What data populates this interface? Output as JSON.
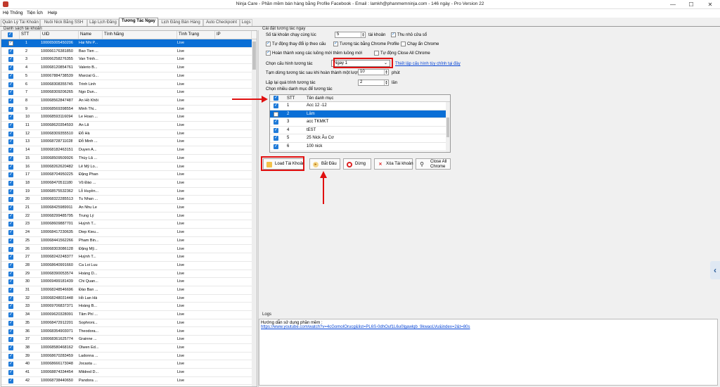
{
  "window": {
    "title": "Ninja Care - Phần mềm bán hàng bằng Profile Facebook - Email : lamkh@phanmemninja.com - 146 ngày - Pro Version 22",
    "minimize": "—",
    "maximize": "☐",
    "close": "✕"
  },
  "menu": [
    "Hệ Thống",
    "Tiện Ích",
    "Help"
  ],
  "tabs": [
    "Quản Lý Tài Khoản",
    "Nuôi Nick Bằng SSH",
    "Lập Lịch Đăng",
    "Tương Tác Ngay",
    "Lịch Đăng Bán Hàng",
    "Auto Checkpoint",
    "Logs"
  ],
  "active_tab": "Tương Tác Ngay",
  "accounts": {
    "group_label": "Danh sách tài khoản",
    "columns": [
      "",
      "STT",
      "UID",
      "Name",
      "Tính Năng",
      "Tình Trạng",
      "IP"
    ],
    "rows": [
      {
        "stt": "1",
        "uid": "100065005450206",
        "name": "Hai Nhi P...",
        "status": "Live"
      },
      {
        "stt": "2",
        "uid": "100066176381850",
        "name": "Bao Tien ...",
        "status": "Live"
      },
      {
        "stt": "3",
        "uid": "100066258276355",
        "name": "Van Trinh...",
        "status": "Live"
      },
      {
        "stt": "4",
        "uid": "100068120854761",
        "name": "Valerio B...",
        "status": "Live"
      },
      {
        "stt": "5",
        "uid": "100067884738539",
        "name": "Marcial G...",
        "status": "Live"
      },
      {
        "stt": "6",
        "uid": "100068308355745",
        "name": "Trinh Linh",
        "status": "Live"
      },
      {
        "stt": "7",
        "uid": "100068309206265",
        "name": "Ngo Dun...",
        "status": "Live"
      },
      {
        "stt": "8",
        "uid": "100068562847487",
        "name": "An Hồ Khôi",
        "status": "Live"
      },
      {
        "stt": "9",
        "uid": "100068569398554",
        "name": "Minh Thi...",
        "status": "Live"
      },
      {
        "stt": "10",
        "uid": "100068593116094",
        "name": "Le Hoan ...",
        "status": "Live"
      },
      {
        "stt": "11",
        "uid": "100068620354593",
        "name": "An Lã",
        "status": "Live"
      },
      {
        "stt": "12",
        "uid": "100068309355510",
        "name": "Đỗ Hà",
        "status": "Live"
      },
      {
        "stt": "13",
        "uid": "100068728711028",
        "name": "Đỗ Minh ...",
        "status": "Live"
      },
      {
        "stt": "14",
        "uid": "100068182463151",
        "name": "Duyen A...",
        "status": "Live"
      },
      {
        "stt": "15",
        "uid": "100068509509926",
        "name": "Thùy Lã ...",
        "status": "Live"
      },
      {
        "stt": "16",
        "uid": "100068262620482",
        "name": "Lê Mỹ Lo...",
        "status": "Live"
      },
      {
        "stt": "17",
        "uid": "100068704950225",
        "name": "Đặng Phan",
        "status": "Live"
      },
      {
        "stt": "18",
        "uid": "100068470511180",
        "name": "Vũ Đào ...",
        "status": "Live"
      },
      {
        "stt": "19",
        "uid": "100068575532362",
        "name": "Lỗ Huyền...",
        "status": "Live"
      },
      {
        "stt": "20",
        "uid": "100068322285513",
        "name": "Tu Nhan ...",
        "status": "Live"
      },
      {
        "stt": "21",
        "uid": "100068425989911",
        "name": "An Nhu Le",
        "status": "Live"
      },
      {
        "stt": "22",
        "uid": "100068299485795",
        "name": "Trung Lý",
        "status": "Live"
      },
      {
        "stt": "23",
        "uid": "100068609887701",
        "name": "Huỳnh T...",
        "status": "Live"
      },
      {
        "stt": "24",
        "uid": "100068417230635",
        "name": "Diep Kieu...",
        "status": "Live"
      },
      {
        "stt": "25",
        "uid": "100068441562266",
        "name": "Pham Bin...",
        "status": "Live"
      },
      {
        "stt": "26",
        "uid": "100068303086128",
        "name": "Đặng Mỹ...",
        "status": "Live"
      },
      {
        "stt": "27",
        "uid": "100068242248377",
        "name": "Huỳnh T...",
        "status": "Live"
      },
      {
        "stt": "28",
        "uid": "100068640991660",
        "name": "Ca Loi Luu",
        "status": "Live"
      },
      {
        "stt": "29",
        "uid": "100068390053574",
        "name": "Hoàng D...",
        "status": "Live"
      },
      {
        "stt": "30",
        "uid": "100069499181439",
        "name": "Chi Quan...",
        "status": "Live"
      },
      {
        "stt": "31",
        "uid": "100068248546696",
        "name": "Đào Ban ...",
        "status": "Live"
      },
      {
        "stt": "32",
        "uid": "100068248031448",
        "name": "Hồ Lan Hà",
        "status": "Live"
      },
      {
        "stt": "33",
        "uid": "100069706837371",
        "name": "Hoàng B...",
        "status": "Live"
      },
      {
        "stt": "34",
        "uid": "100069620328091",
        "name": "Tâm Phí ...",
        "status": "Live"
      },
      {
        "stt": "35",
        "uid": "100068472912201",
        "name": "Sophroni...",
        "status": "Live"
      },
      {
        "stt": "36",
        "uid": "100068354903071",
        "name": "Theodora...",
        "status": "Live"
      },
      {
        "stt": "37",
        "uid": "100068361625774",
        "name": "Grainne ...",
        "status": "Live"
      },
      {
        "stt": "38",
        "uid": "100068580468162",
        "name": "Olwen Ed...",
        "status": "Live"
      },
      {
        "stt": "39",
        "uid": "100068670283459",
        "name": "Ladonna ...",
        "status": "Live"
      },
      {
        "stt": "40",
        "uid": "100068666173048",
        "name": "Jocasta ...",
        "status": "Live"
      },
      {
        "stt": "41",
        "uid": "100068874334454",
        "name": "Mildred D...",
        "status": "Live"
      },
      {
        "stt": "42",
        "uid": "100068738440650",
        "name": "Pandora ...",
        "status": "Live"
      }
    ]
  },
  "settings": {
    "group_label": "Cài đặt tương tác ngay",
    "concurrent_label": "Số tài khoản chạy cùng lúc",
    "concurrent_value": "5",
    "concurrent_unit": "tài khoản",
    "minimize_label": "Thu nhỏ cửa sổ",
    "auto_ip_label": "Tự động thay đổi ip theo cấu",
    "chrome_profile_label": "Tương tác bằng Chrome Profile",
    "hidden_chrome_label": "Chạy ẩn Chrome",
    "add_thread_label": "Hoàn thành xong các luồng mới thêm luồng mới",
    "auto_close_label": "Tự động Close All Chrome",
    "config_label": "Chọn cấu hình tương tác",
    "config_value": "Ngay 1",
    "config_link": "Thiết lập cấu hình tùy chỉnh tại đây",
    "pause_label": "Tạm dừng tương tác sau khi hoàn thành một lượt",
    "pause_value": "10",
    "pause_unit": "phút",
    "repeat_label": "Lặp lại quá trình tương tác",
    "repeat_value": "2",
    "repeat_unit": "lần",
    "category_group_label": "Chọn nhiều danh mục để tương tác"
  },
  "categories": {
    "columns": [
      "",
      "STT",
      "Tên danh mục"
    ],
    "rows": [
      {
        "stt": "1",
        "name": "Acc 12 -12",
        "checked": true
      },
      {
        "stt": "2",
        "name": "Lâm",
        "checked": false
      },
      {
        "stt": "3",
        "name": "acc TKMKT",
        "checked": true
      },
      {
        "stt": "4",
        "name": "tEST",
        "checked": true
      },
      {
        "stt": "5",
        "name": "25 Nick Âu Cơ",
        "checked": true
      },
      {
        "stt": "6",
        "name": "100 nick",
        "checked": true
      }
    ]
  },
  "buttons": {
    "load": "Load Tài Khoản",
    "start": "Bắt Đầu",
    "stop": "Dừng",
    "delete": "Xóa Tài khoản",
    "close_all_1": "Close All",
    "close_all_2": "Chrome"
  },
  "logs": {
    "group_label": "Logs",
    "line1": "Hướng dẫn sử dụng phần mềm :",
    "line2": "https://www.youtube.com/watch?v=4cGomoIOrucg&list=PL6S-0dhOuf1L6u0lgawlqb_9kwaoLVu&index=2&t=80s"
  },
  "colors": {
    "selection": "#0a6fd6",
    "annotation": "#e01010",
    "link": "#0645d6"
  }
}
